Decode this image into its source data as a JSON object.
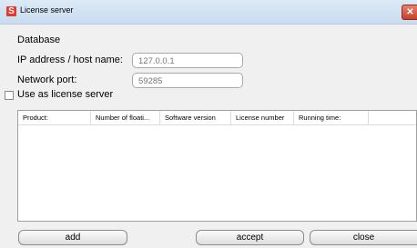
{
  "window": {
    "title": "License server",
    "app_icon": "S",
    "close_glyph": "✕"
  },
  "form": {
    "section_label": "Database",
    "host_label": "IP address / host name:",
    "host_value": "127.0.0.1",
    "port_label": "Network port:",
    "port_value": "59285",
    "use_as_server_label": "Use as license server",
    "use_as_server_checked": false
  },
  "table": {
    "columns": [
      "Product:",
      "Number of floati...",
      "Software version",
      "License number",
      "Running time:"
    ],
    "rows": []
  },
  "buttons": {
    "add": "add",
    "accept": "accept",
    "close": "close"
  }
}
